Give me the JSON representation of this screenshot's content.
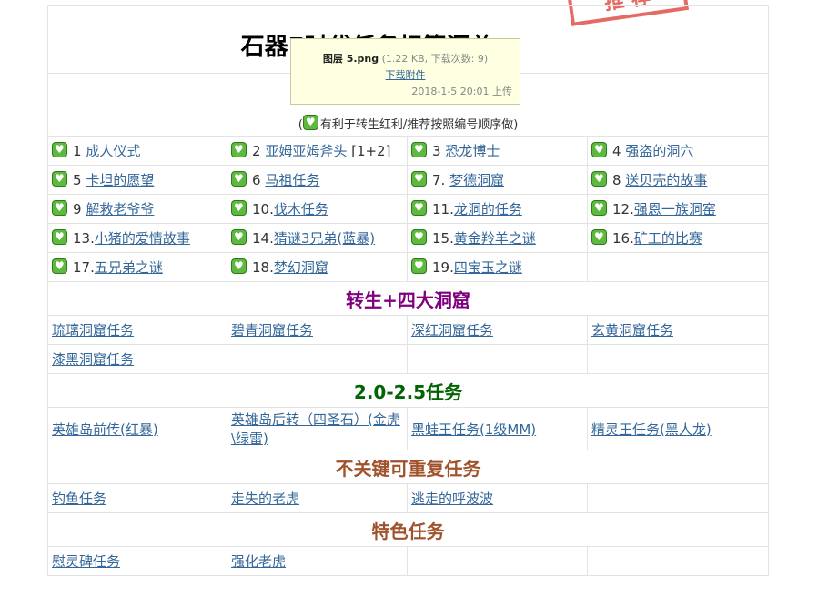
{
  "stamp": {
    "text": "推 荐",
    "color": "#e0524a"
  },
  "title": "石器E时代任务标签汇总",
  "tooltip": {
    "filename": "图层 5.png",
    "meta": "(1.22 KB, 下载次数: 9)",
    "download": "下载附件",
    "uploaded": "2018-1-5 20:01 上传"
  },
  "note": {
    "open": "(",
    "text": "有利于转生红利/推荐按照编号顺序做)"
  },
  "quests": [
    {
      "num": "1 ",
      "label": "成人仪式"
    },
    {
      "num": "2 ",
      "label": "亚姆亚姆斧头",
      "suffix": " [1+2]"
    },
    {
      "num": "3 ",
      "label": "恐龙博士"
    },
    {
      "num": "4 ",
      "label": "强盗的洞穴"
    },
    {
      "num": "5 ",
      "label": "卡坦的愿望"
    },
    {
      "num": "6 ",
      "label": "马祖任务"
    },
    {
      "num": "7. ",
      "label": "梦德洞窟"
    },
    {
      "num": "8 ",
      "label": "送贝壳的故事"
    },
    {
      "num": "9 ",
      "label": "解救老爷爷"
    },
    {
      "num": "10.",
      "label": "伐木任务"
    },
    {
      "num": "11.",
      "label": "龙洞的任务"
    },
    {
      "num": "12.",
      "label": "强恩一族洞窑"
    },
    {
      "num": "13.",
      "label": "小猪的爱情故事"
    },
    {
      "num": "14.",
      "label": "猜谜3兄弟(蓝暴)"
    },
    {
      "num": "15.",
      "label": "黄金羚羊之谜"
    },
    {
      "num": "16.",
      "label": "矿工的比赛"
    },
    {
      "num": "17.",
      "label": "五兄弟之谜"
    },
    {
      "num": "18.",
      "label": "梦幻洞窟"
    },
    {
      "num": "19.",
      "label": "四宝玉之谜"
    }
  ],
  "sections": [
    {
      "title": "转生+四大洞窟",
      "color": "#800080",
      "items": [
        "琉璃洞窟任务",
        "碧青洞窟任务",
        "深红洞窟任务",
        "玄黄洞窟任务",
        "漆黑洞窟任务"
      ]
    },
    {
      "title": "2.0-2.5任务",
      "color": "#006400",
      "items": [
        "英雄岛前传(红暴)",
        "英雄岛后转（四圣石）(金虎\\绿雷)",
        "黑蛙王任务(1级MM)",
        "精灵王任务(黑人龙)"
      ]
    },
    {
      "title": "不关键可重复任务",
      "color": "#a0522d",
      "items": [
        "钓鱼任务",
        "走失的老虎",
        "逃走的呼波波"
      ]
    },
    {
      "title": "特色任务",
      "color": "#a0522d",
      "items": [
        "慰灵碑任务",
        "强化老虎"
      ]
    }
  ]
}
